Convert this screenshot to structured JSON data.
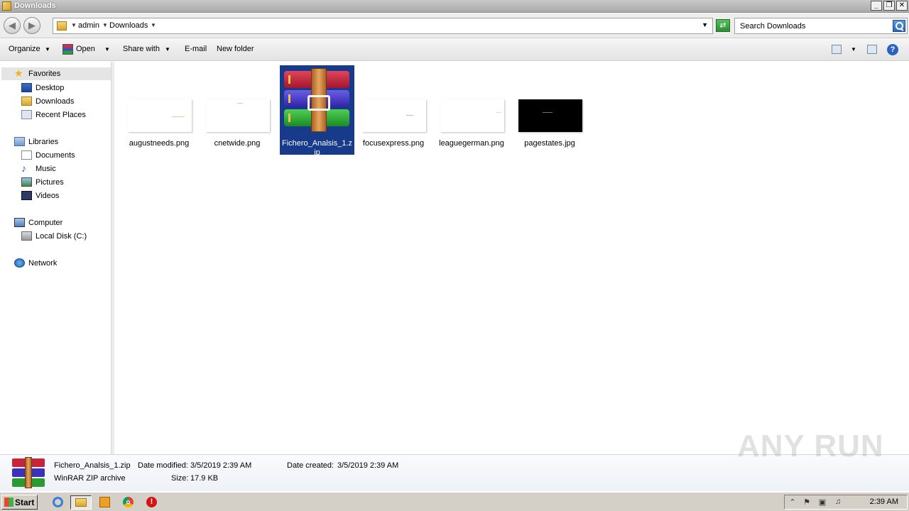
{
  "window": {
    "title": "Downloads",
    "controls": [
      "_",
      "❐",
      "✕"
    ]
  },
  "address": {
    "crumbs": [
      "admin",
      "Downloads"
    ],
    "search_placeholder": "Search Downloads"
  },
  "toolbar": {
    "organize": "Organize",
    "open": "Open",
    "share_with": "Share with",
    "email": "E-mail",
    "new_folder": "New folder"
  },
  "nav": {
    "favorites": "Favorites",
    "desktop": "Desktop",
    "downloads": "Downloads",
    "recent_places": "Recent Places",
    "libraries": "Libraries",
    "documents": "Documents",
    "music": "Music",
    "pictures": "Pictures",
    "videos": "Videos",
    "computer": "Computer",
    "local_disk": "Local Disk (C:)",
    "network": "Network"
  },
  "files": [
    {
      "name": "augustneeds.png"
    },
    {
      "name": "cnetwide.png"
    },
    {
      "name": "Fichero_Analsis_1.zip",
      "label_line1": "Fichero_Analsis_1.z",
      "label_line2": "ip",
      "selected": true
    },
    {
      "name": "focusexpress.png"
    },
    {
      "name": "leaguegerman.png"
    },
    {
      "name": "pagestates.jpg"
    }
  ],
  "details": {
    "filename": "Fichero_Analsis_1.zip",
    "type": "WinRAR ZIP archive",
    "date_modified_label": "Date modified:",
    "date_modified": "3/5/2019 2:39 AM",
    "size_label": "Size:",
    "size": "17.9 KB",
    "date_created_label": "Date created:",
    "date_created": "3/5/2019 2:39 AM"
  },
  "watermark": "ANY RUN",
  "taskbar": {
    "start": "Start",
    "clock": "2:39 AM"
  }
}
